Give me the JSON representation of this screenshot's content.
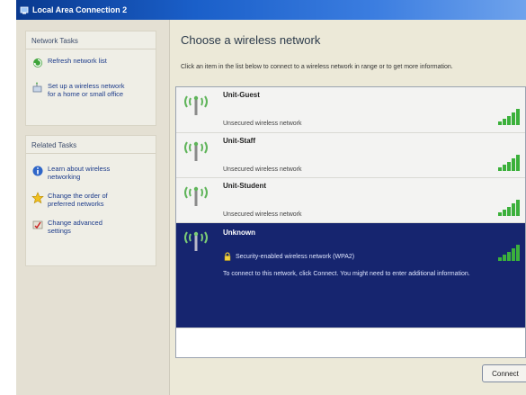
{
  "window": {
    "title": "Local Area Connection 2"
  },
  "sidebar": {
    "network_tasks": {
      "header": "Network Tasks",
      "items": [
        {
          "label": "Refresh network list",
          "icon": "refresh-icon"
        },
        {
          "label": "Set up a wireless network\nfor a home or small office",
          "icon": "setup-network-icon"
        }
      ]
    },
    "related_tasks": {
      "header": "Related Tasks",
      "items": [
        {
          "label": "Learn about wireless\nnetworking",
          "icon": "info-icon"
        },
        {
          "label": "Change the order of\npreferred networks",
          "icon": "star-icon"
        },
        {
          "label": "Change advanced\nsettings",
          "icon": "settings-icon"
        }
      ]
    }
  },
  "main": {
    "heading": "Choose a wireless network",
    "instructions": "Click an item in the list below to connect to a wireless network in range or to get more information.",
    "networks": [
      {
        "name": "Unit-Guest",
        "status": "Unsecured wireless network",
        "selected": false
      },
      {
        "name": "Unit-Staff",
        "status": "Unsecured wireless network",
        "selected": false
      },
      {
        "name": "Unit-Student",
        "status": "Unsecured wireless network",
        "selected": false
      },
      {
        "name": "Unknown",
        "status": "Security-enabled wireless network (WPA2)",
        "selected": true,
        "note": "To connect to this network, click Connect. You might need to enter additional information."
      }
    ],
    "connect_label": "Connect"
  },
  "colors": {
    "selected_row": "#16256f",
    "signal_green": "#3bb03b",
    "antenna_green": "#5fb45a",
    "link_blue": "#1c3b8a"
  }
}
